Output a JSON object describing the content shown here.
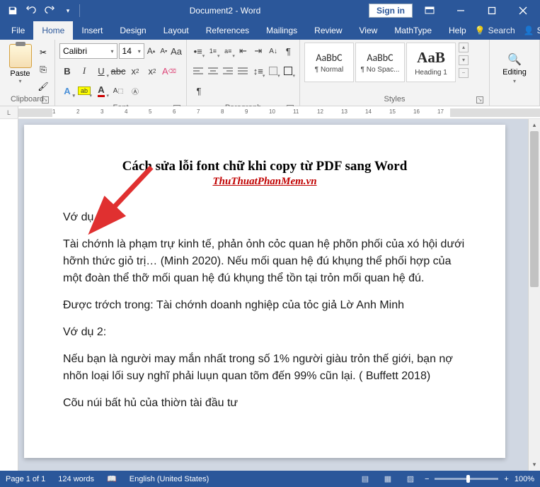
{
  "titlebar": {
    "document_name": "Document2",
    "app_name": "Word",
    "signin": "Sign in"
  },
  "tabs": {
    "items": [
      "File",
      "Home",
      "Insert",
      "Design",
      "Layout",
      "References",
      "Mailings",
      "Review",
      "View",
      "MathType",
      "Help"
    ],
    "active": "Home",
    "tell_me": "Search",
    "share": "Share"
  },
  "ribbon": {
    "clipboard": {
      "label": "Clipboard",
      "paste": "Paste"
    },
    "font": {
      "label": "Font",
      "name": "Calibri",
      "size": "14"
    },
    "paragraph": {
      "label": "Paragraph"
    },
    "styles": {
      "label": "Styles",
      "items": [
        {
          "preview": "AaBbC",
          "name": "¶ Normal"
        },
        {
          "preview": "AaBbC",
          "name": "¶ No Spac..."
        },
        {
          "preview": "AaB",
          "name": "Heading 1"
        }
      ]
    },
    "editing": {
      "label": "Editing"
    }
  },
  "document": {
    "title": "Cách sửa lỗi font chữ khi copy từ PDF sang Word",
    "subtitle": "ThuThuatPhanMem.vn",
    "p1": "Vớ dụ 1:",
    "p2": "Tài chớnh là phạm trự kinh tế, phản ỏnh cỏc quan hệ phõn phối của xó hội dưới hỡnh thức giỏ trị… (Minh 2020). Nếu mối quan hệ đú khụng thể phối hợp của một đoàn thể thỡ mối quan hệ đú khụng thể tồn tại trỏn mối quan hệ đú.",
    "p3": "Được trớch trong: Tài chớnh doanh nghiệp của tỏc giả Lờ Anh Minh",
    "p4": "Vớ dụ 2:",
    "p5": "Nếu bạn là người may mắn nhất trong số 1% người giàu trỏn thế giới, bạn nợ nhõn loại lối suy nghĩ phải luụn quan tõm đến 99% cũn lại. ( Buffett 2018)",
    "p6": "Cõu núi bất hủ của thiờn tài đầu tư"
  },
  "status": {
    "page": "Page 1 of 1",
    "words": "124 words",
    "language": "English (United States)",
    "zoom": "100%"
  },
  "ruler": {
    "marks": [
      "1",
      "2",
      "3",
      "4",
      "5",
      "6",
      "7",
      "8",
      "9",
      "10",
      "11",
      "12",
      "13",
      "14",
      "15",
      "16",
      "17"
    ]
  }
}
